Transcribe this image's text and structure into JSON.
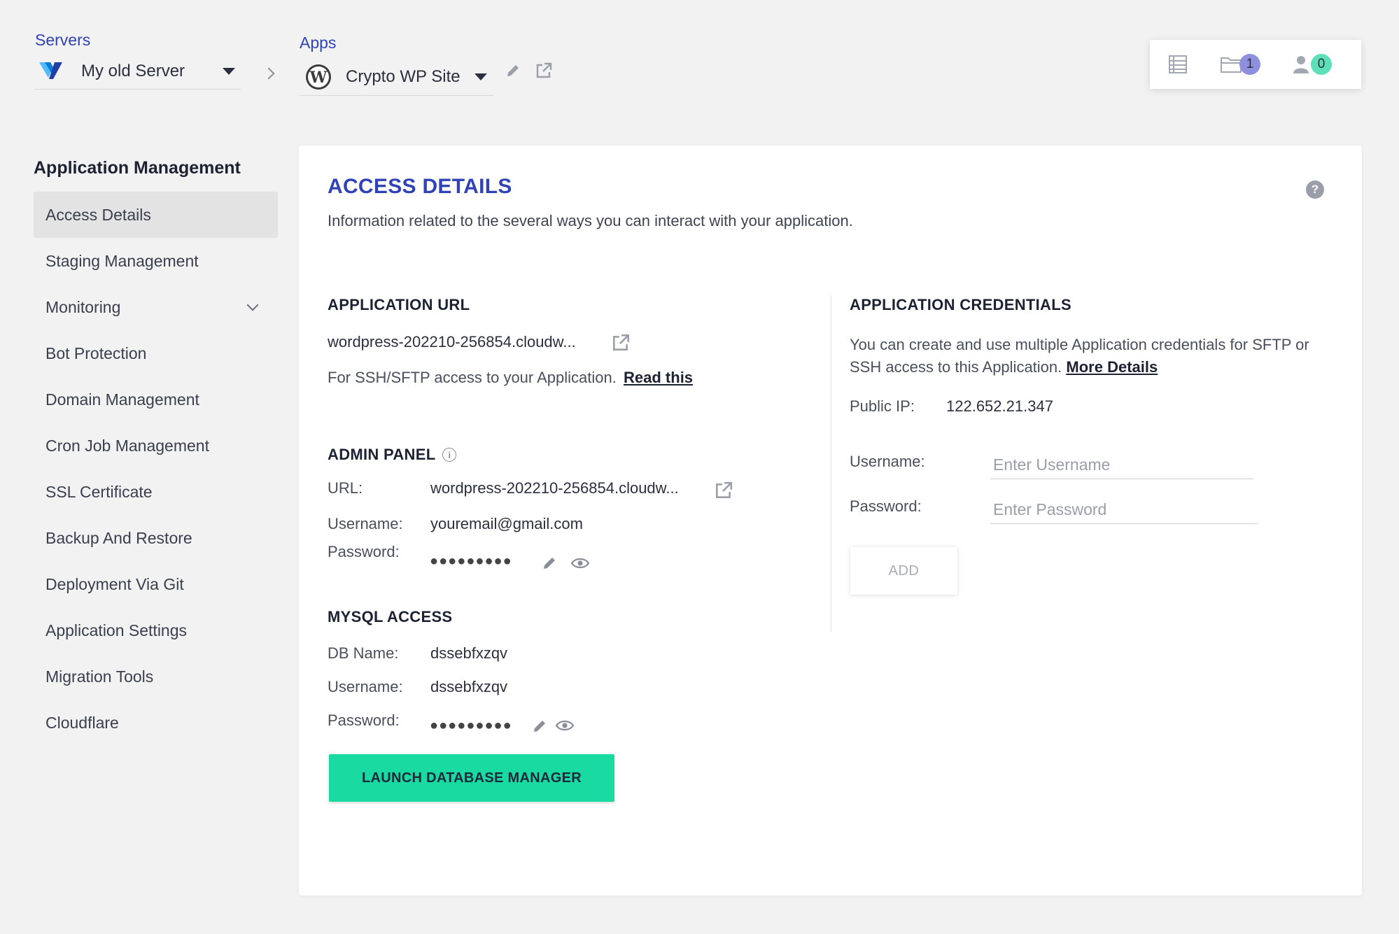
{
  "header": {
    "servers_label": "Servers",
    "server_name": "My old Server",
    "apps_label": "Apps",
    "app_name": "Crypto WP Site",
    "files_badge": "1",
    "users_badge": "0"
  },
  "sidebar": {
    "title": "Application Management",
    "items": [
      {
        "label": "Access Details",
        "active": true
      },
      {
        "label": "Staging Management"
      },
      {
        "label": "Monitoring",
        "expandable": true
      },
      {
        "label": "Bot Protection"
      },
      {
        "label": "Domain Management"
      },
      {
        "label": "Cron Job Management"
      },
      {
        "label": "SSL Certificate"
      },
      {
        "label": "Backup And Restore"
      },
      {
        "label": "Deployment Via Git"
      },
      {
        "label": "Application Settings"
      },
      {
        "label": "Migration Tools"
      },
      {
        "label": "Cloudflare"
      }
    ]
  },
  "main": {
    "title": "ACCESS DETAILS",
    "subtitle": "Information related to the several ways you can interact with your application.",
    "app_url": {
      "heading": "APPLICATION URL",
      "url": "wordpress-202210-256854.cloudw...",
      "ssh_text": "For SSH/SFTP access to your Application.",
      "ssh_link": "Read this"
    },
    "admin_panel": {
      "heading": "ADMIN PANEL",
      "url_label": "URL:",
      "url": "wordpress-202210-256854.cloudw...",
      "username_label": "Username:",
      "username": "youremail@gmail.com",
      "password_label": "Password:",
      "password_mask": "●●●●●●●●●"
    },
    "mysql": {
      "heading": "MYSQL ACCESS",
      "db_label": "DB Name:",
      "db_name": "dssebfxzqv",
      "username_label": "Username:",
      "username": "dssebfxzqv",
      "password_label": "Password:",
      "password_mask": "●●●●●●●●●",
      "launch_button": "LAUNCH DATABASE MANAGER"
    },
    "credentials": {
      "heading": "APPLICATION CREDENTIALS",
      "desc": "You can create and use multiple Application credentials for SFTP or SSH access to this Application.",
      "more_link": "More Details",
      "ip_label": "Public IP:",
      "ip": "122.652.21.347",
      "username_label": "Username:",
      "username_placeholder": "Enter Username",
      "password_label": "Password:",
      "password_placeholder": "Enter Password",
      "add_button": "ADD"
    }
  },
  "colors": {
    "accent_blue": "#2f43b6",
    "launch_green": "#19dba1",
    "badge_purple": "#8f8fe0",
    "badge_green": "#5de0b8"
  }
}
